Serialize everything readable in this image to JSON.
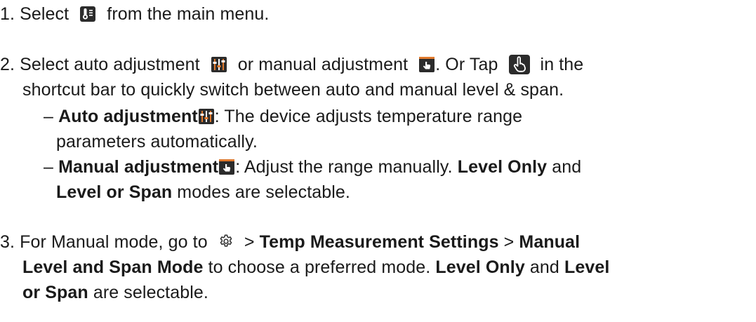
{
  "steps": [
    {
      "number": "1.",
      "lines": [
        {
          "t1": "Select",
          "t2": "from the main menu."
        }
      ]
    },
    {
      "number": "2.",
      "lines": [
        {
          "t1": "Select auto adjustment",
          "t2": "or manual adjustment",
          "t3": ". Or Tap",
          "t4": "in the"
        },
        {
          "t1": "shortcut bar to quickly switch between auto and manual level & span."
        }
      ],
      "bullets": [
        {
          "dash": "–",
          "term": "Auto adjustment",
          "line1": ": The device adjusts temperature range",
          "line2": "parameters automatically."
        },
        {
          "dash": "–",
          "term": "Manual adjustment",
          "line1_a": ": Adjust the range manually.",
          "mode1": "Level Only",
          "line1_b": "and",
          "mode2": "Level or Span",
          "line2": "modes are selectable."
        }
      ]
    },
    {
      "number": "3.",
      "lines": [
        {
          "t1": "For Manual mode, go to",
          "sep1": ">",
          "path1": "Temp Measurement Settings",
          "sep2": ">",
          "path2a": "Manual"
        },
        {
          "path2b": "Level and Span Mode",
          "t1": "to choose a preferred mode.",
          "mode1": "Level Only",
          "t2": "and",
          "mode2a": "Level"
        },
        {
          "mode2b": "or Span",
          "t1": "are selectable."
        }
      ]
    }
  ],
  "icons": {
    "thermometer": "thermometer-icon",
    "auto": "auto-adjustment-icon",
    "manual": "manual-adjustment-icon",
    "tap": "tap-hand-icon",
    "settings": "gear-icon"
  },
  "colors": {
    "text": "#1a1a1a",
    "icon_dark": "#2b2b2b",
    "icon_orange": "#e07a2e"
  }
}
